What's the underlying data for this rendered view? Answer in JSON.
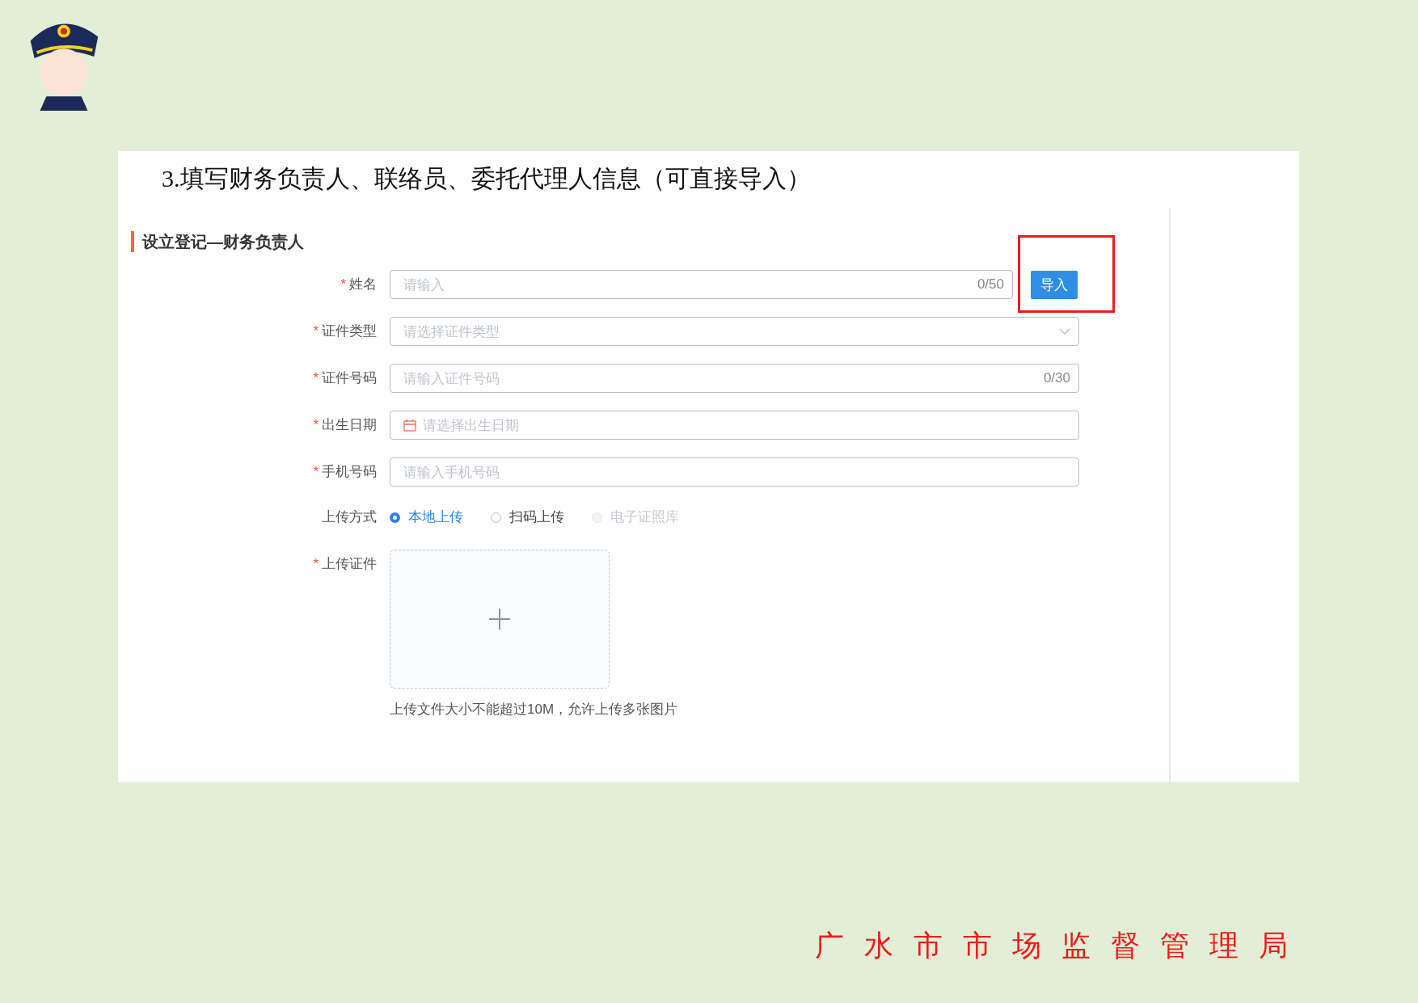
{
  "heading": "3.填写财务负责人、联络员、委托代理人信息（可直接导入）",
  "form": {
    "section_title": "设立登记—财务负责人",
    "fields": [
      {
        "kind": "text",
        "label": "姓名",
        "required_mark": "*",
        "placeholder": "请输入",
        "counter": "0/50",
        "import_button": "导入",
        "highlighted": true
      },
      {
        "kind": "select",
        "label": "证件类型",
        "required_mark": "*",
        "placeholder": "请选择证件类型"
      },
      {
        "kind": "text",
        "label": "证件号码",
        "required_mark": "*",
        "placeholder": "请输入证件号码",
        "counter": "0/30"
      },
      {
        "kind": "date",
        "label": "出生日期",
        "required_mark": "*",
        "placeholder": "请选择出生日期"
      },
      {
        "kind": "text",
        "label": "手机号码",
        "required_mark": "*",
        "placeholder": "请输入手机号码"
      },
      {
        "kind": "radio",
        "label": "上传方式",
        "options": [
          {
            "label": "本地上传",
            "selected": true,
            "disabled": false
          },
          {
            "label": "扫码上传",
            "selected": false,
            "disabled": false
          },
          {
            "label": "电子证照库",
            "selected": false,
            "disabled": true
          }
        ]
      },
      {
        "kind": "upload",
        "label": "上传证件",
        "required_mark": "*",
        "hint": "上传文件大小不能超过10M，允许上传多张图片"
      }
    ]
  },
  "footer": "广水市市场监督管理局"
}
